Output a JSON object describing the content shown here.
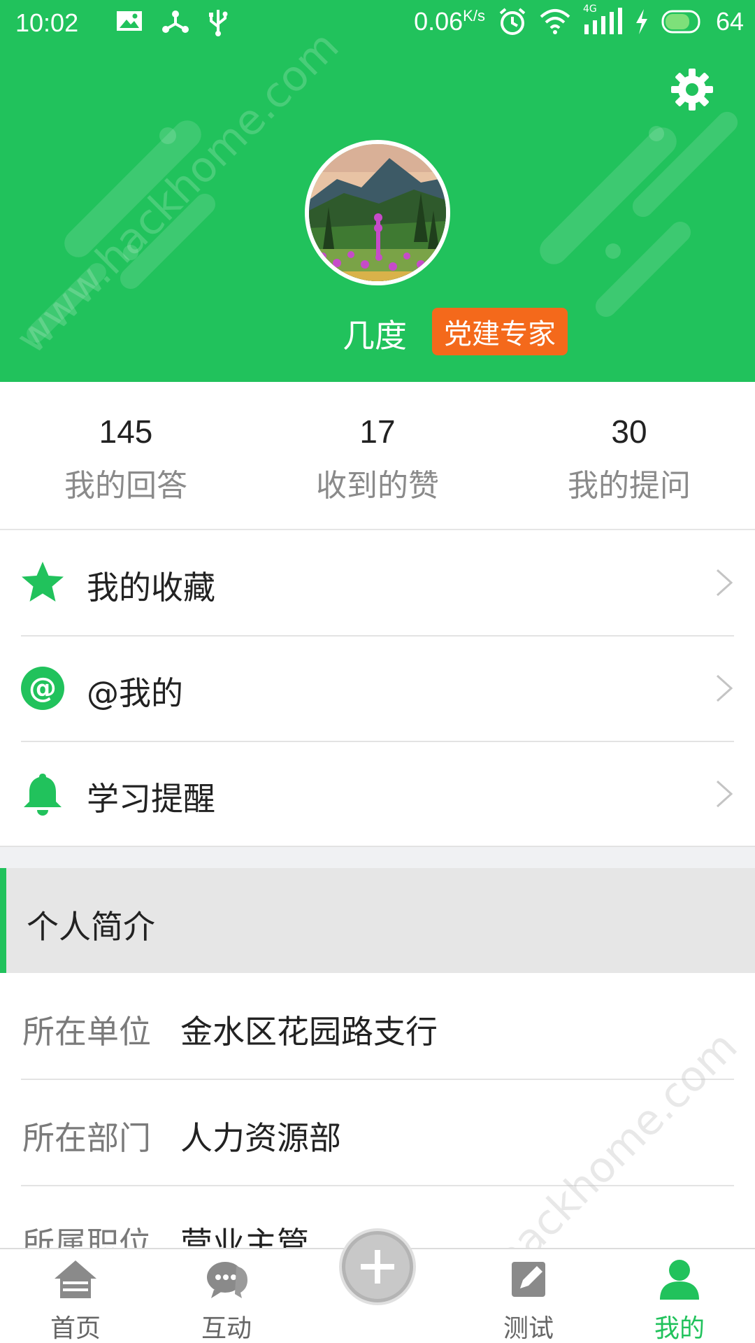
{
  "status_bar": {
    "time": "10:02",
    "net_speed": "0.06",
    "net_unit": "K/s",
    "network_type": "4G",
    "battery": "64"
  },
  "profile": {
    "name": "几度",
    "badge": "党建专家"
  },
  "stats": [
    {
      "value": "145",
      "label": "我的回答"
    },
    {
      "value": "17",
      "label": "收到的赞"
    },
    {
      "value": "30",
      "label": "我的提问"
    }
  ],
  "menu": [
    {
      "label": "我的收藏",
      "icon": "star-icon"
    },
    {
      "label": "@我的",
      "icon": "at-icon"
    },
    {
      "label": "学习提醒",
      "icon": "bell-icon"
    }
  ],
  "section": {
    "title": "个人简介"
  },
  "info": [
    {
      "key": "所在单位",
      "value": "金水区花园路支行"
    },
    {
      "key": "所在部门",
      "value": "人力资源部"
    },
    {
      "key": "所属职位",
      "value": "营业主管"
    }
  ],
  "nav": [
    {
      "label": "首页",
      "icon": "home-icon"
    },
    {
      "label": "互动",
      "icon": "chat-icon"
    },
    {
      "label": "",
      "icon": "add-icon"
    },
    {
      "label": "测试",
      "icon": "edit-icon"
    },
    {
      "label": "我的",
      "icon": "user-icon"
    }
  ],
  "watermark": "www.hackhome.com",
  "colors": {
    "primary": "#21c25c",
    "badge": "#f4691b",
    "active_nav": "#21c25c"
  }
}
